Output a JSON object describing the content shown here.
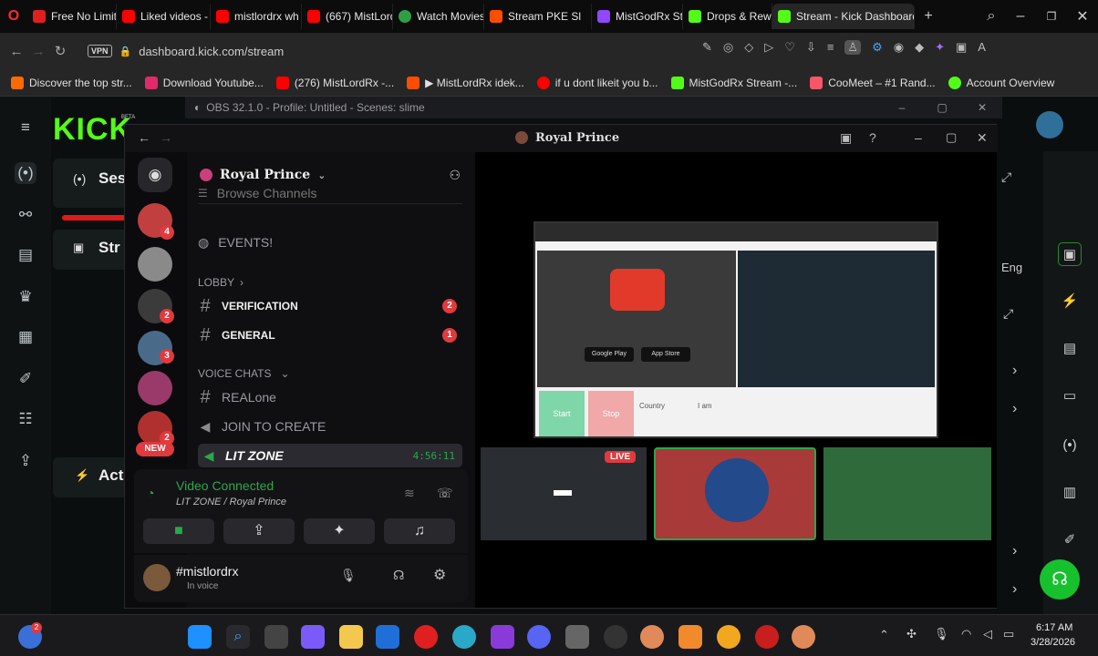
{
  "browser": {
    "tabs": [
      {
        "label": "Free No Limit",
        "color": "#e02020"
      },
      {
        "label": "Liked videos -",
        "color": "#ff0000"
      },
      {
        "label": "mistlordrx wh",
        "color": "#ff0000"
      },
      {
        "label": "(667) MistLord",
        "color": "#ff0000"
      },
      {
        "label": "Watch Movies",
        "color": "#2ea043"
      },
      {
        "label": "Stream PKE Sl",
        "color": "#ff4d00"
      },
      {
        "label": "MistGodRx Str",
        "color": "#9147ff"
      },
      {
        "label": "Drops & Rewa",
        "color": "#53fc18"
      },
      {
        "label": "Stream - Kick Dashboard",
        "color": "#53fc18"
      }
    ],
    "url": "dashboard.kick.com/stream",
    "vpn_label": "VPN",
    "bookmarks": [
      "Discover the top str...",
      "Download Youtube...",
      "(276) MistLordRx -...",
      "▶ MistLordRx idek...",
      "if u dont likeit you b...",
      "MistGodRx Stream -...",
      "CooMeet – #1 Rand...",
      "Account Overview"
    ]
  },
  "kick": {
    "logo": "KICK",
    "beta": "BETA",
    "card_session": "Ses",
    "card_stream": "Str",
    "card_actions": "Act",
    "lang": "Eng"
  },
  "obs": {
    "title": "OBS 32.1.0 - Profile: Untitled - Scenes: slime"
  },
  "discord": {
    "window_title": "Royal Prince",
    "server_name": "Royal Prince",
    "browse": "Browse Channels",
    "events": "EVENTS!",
    "cat_lobby": "LOBBY",
    "verification": "VERIFICATION",
    "verification_count": "2",
    "general": "GENERAL",
    "general_count": "1",
    "cat_voice": "VOICE CHATS",
    "realone": "REALone",
    "join": "JOIN TO CREATE",
    "litzone": "LIT ZONE",
    "timer": "4:56:11",
    "new_badge": "NEW",
    "video_connected": "Video Connected",
    "voice_path": "LIT ZONE / Royal Prince",
    "username": "#mistlordrx",
    "user_status": "In voice",
    "live_badge": "LIVE",
    "guild_badges": [
      "4",
      "2",
      "3",
      "2"
    ]
  },
  "stream_preview": {
    "start": "Start",
    "stop": "Stop",
    "country": "Country",
    "i_am": "I am",
    "google": "Google Play",
    "appstore": "App Store"
  },
  "taskbar": {
    "time": "6:17 AM",
    "date": "3/28/2026",
    "notif_count": "2"
  }
}
